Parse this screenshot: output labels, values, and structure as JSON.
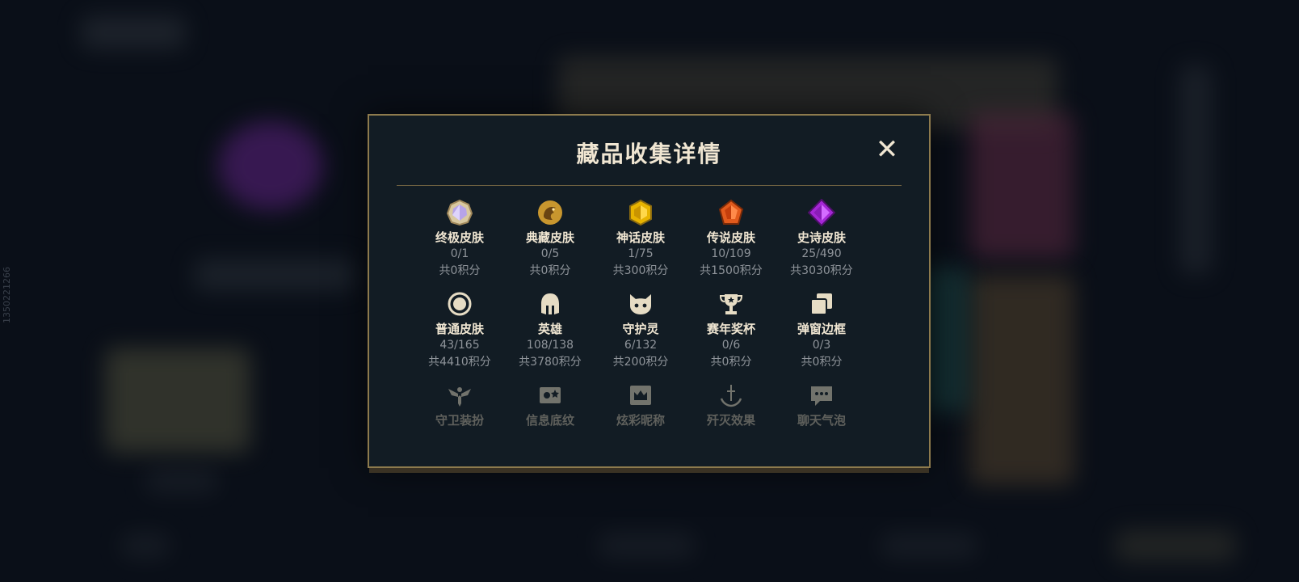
{
  "side_id": "1350221266",
  "modal": {
    "title": "藏品收集详情",
    "close_label": "✕"
  },
  "items": [
    {
      "label": "终极皮肤",
      "count": "0/1",
      "points": "共0积分",
      "icon": "ultimate-gem-icon"
    },
    {
      "label": "典藏皮肤",
      "count": "0/5",
      "points": "共0积分",
      "icon": "dragon-emblem-icon"
    },
    {
      "label": "神话皮肤",
      "count": "1/75",
      "points": "共300积分",
      "icon": "mythic-gem-icon"
    },
    {
      "label": "传说皮肤",
      "count": "10/109",
      "points": "共1500积分",
      "icon": "legendary-gem-icon"
    },
    {
      "label": "史诗皮肤",
      "count": "25/490",
      "points": "共3030积分",
      "icon": "epic-gem-icon"
    },
    {
      "label": "普通皮肤",
      "count": "43/165",
      "points": "共4410积分",
      "icon": "ring-icon"
    },
    {
      "label": "英雄",
      "count": "108/138",
      "points": "共3780积分",
      "icon": "helmet-icon"
    },
    {
      "label": "守护灵",
      "count": "6/132",
      "points": "共200积分",
      "icon": "critter-icon"
    },
    {
      "label": "赛年奖杯",
      "count": "0/6",
      "points": "共0积分",
      "icon": "trophy-icon"
    },
    {
      "label": "弹窗边框",
      "count": "0/3",
      "points": "共0积分",
      "icon": "frames-icon"
    },
    {
      "label": "守卫装扮",
      "icon": "ward-icon"
    },
    {
      "label": "信息底纹",
      "icon": "banner-icon"
    },
    {
      "label": "炫彩昵称",
      "icon": "crown-card-icon"
    },
    {
      "label": "歼灭效果",
      "icon": "sword-icon"
    },
    {
      "label": "聊天气泡",
      "icon": "chat-bubble-icon"
    }
  ],
  "colors": {
    "accent_gold": "#8d7a4d",
    "title_text": "#f0e6d2",
    "sub_text": "#8f949a",
    "panel_bg": "#121c24"
  }
}
